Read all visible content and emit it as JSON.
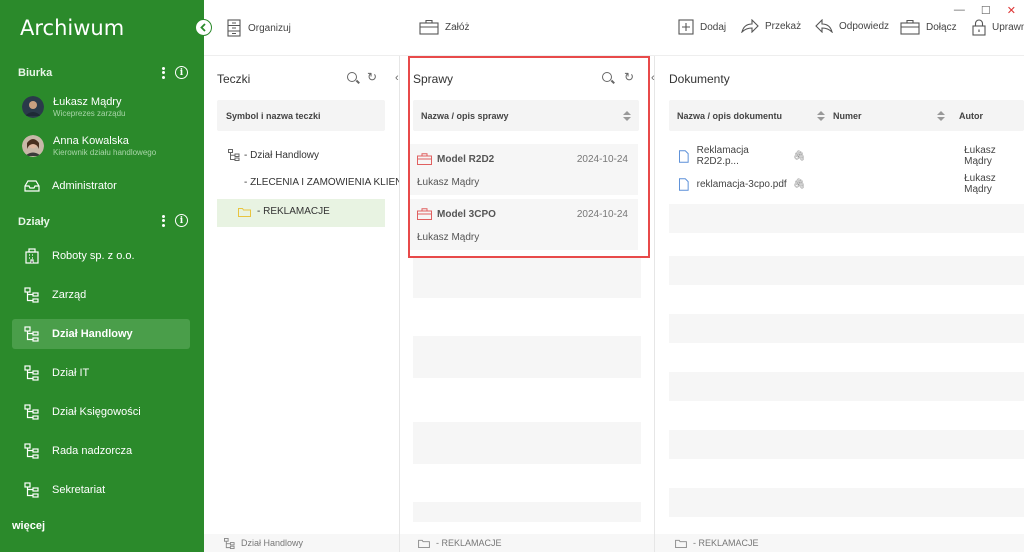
{
  "app": {
    "title": "Archiwum"
  },
  "sidebar": {
    "desks_header": "Biurka",
    "users": [
      {
        "name": "Łukasz Mądry",
        "role": "Wiceprezes zarządu"
      },
      {
        "name": "Anna Kowalska",
        "role": "Kierownik działu handlowego"
      }
    ],
    "admin_label": "Administrator",
    "departments_header": "Działy",
    "departments": [
      {
        "label": "Roboty sp. z o.o."
      },
      {
        "label": "Zarząd"
      },
      {
        "label": "Dział Handlowy"
      },
      {
        "label": "Dział IT"
      },
      {
        "label": "Dział Księgowości"
      },
      {
        "label": "Rada nadzorcza"
      },
      {
        "label": "Sekretariat"
      }
    ],
    "more_label": "więcej"
  },
  "toolbar": {
    "organize": "Organizuj",
    "create": "Załóż",
    "add": "Dodaj",
    "forward": "Przekaż",
    "reply": "Odpowiedz",
    "attach": "Dołącz",
    "permissions": "Uprawn"
  },
  "folders_panel": {
    "title": "Teczki",
    "column_header": "Symbol i nazwa teczki",
    "tree": [
      {
        "label": "- Dział Handlowy"
      },
      {
        "label": "- ZLECENIA I ZAMÓWIENIA KLIENTÓW"
      },
      {
        "label": "- REKLAMACJE"
      }
    ],
    "footer": "Dział Handlowy"
  },
  "cases_panel": {
    "title": "Sprawy",
    "column_header": "Nazwa / opis sprawy",
    "cases": [
      {
        "name": "Model R2D2",
        "date": "2024-10-24",
        "owner": "Łukasz Mądry"
      },
      {
        "name": "Model 3CPO",
        "date": "2024-10-24",
        "owner": "Łukasz Mądry"
      }
    ],
    "footer": "- REKLAMACJE"
  },
  "documents_panel": {
    "title": "Dokumenty",
    "columns": [
      "Nazwa / opis dokumentu",
      "Numer",
      "Autor"
    ],
    "rows": [
      {
        "name": "Reklamacja R2D2.p...",
        "number": "",
        "author": "Łukasz Mądry"
      },
      {
        "name": "reklamacja-3cpo.pdf",
        "number": "",
        "author": "Łukasz Mądry"
      }
    ],
    "footer": "- REKLAMACJE"
  },
  "colors": {
    "sidebar": "#2b8a2b",
    "active": "#4a9e4a",
    "highlight": "#e84a4a",
    "case_icon": "#e06060",
    "folder_icon": "#e8c440"
  }
}
